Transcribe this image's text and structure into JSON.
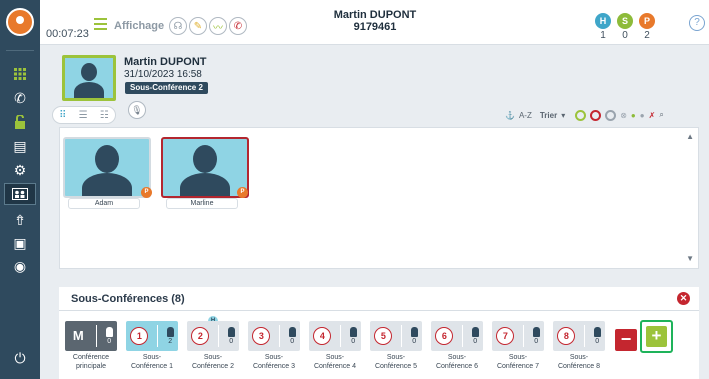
{
  "header": {
    "timer": "00:07:23",
    "display_label": "Affichage",
    "caller_name": "Martin DUPONT",
    "caller_number": "9179461",
    "stats": [
      {
        "letter": "H",
        "count": "1",
        "color": "#3fa6c9"
      },
      {
        "letter": "S",
        "count": "0",
        "color": "#8dbb3a"
      },
      {
        "letter": "P",
        "count": "2",
        "color": "#e8792b"
      }
    ],
    "help": "?"
  },
  "profile": {
    "name": "Martin DUPONT",
    "datetime": "31/10/2023 16:58",
    "conference_badge": "Sous-Conférence 2"
  },
  "toolbar": {
    "sort_az": "A-Z",
    "sort_label": "Trier"
  },
  "participants": [
    {
      "name": "Adam",
      "badge": "P",
      "selected": false
    },
    {
      "name": "Marline",
      "badge": "P",
      "selected": true
    }
  ],
  "subconferences": {
    "title": "Sous-Conférences (8)",
    "main": {
      "letter": "M",
      "count": "0",
      "label_line1": "Conférence",
      "label_line2": "principale"
    },
    "items": [
      {
        "num": "1",
        "count": "2",
        "label_line1": "Sous-",
        "label_line2": "Conférence 1"
      },
      {
        "num": "2",
        "count": "0",
        "label_line1": "Sous-",
        "label_line2": "Conférence 2",
        "badge": "H"
      },
      {
        "num": "3",
        "count": "0",
        "label_line1": "Sous-",
        "label_line2": "Conférence 3"
      },
      {
        "num": "4",
        "count": "0",
        "label_line1": "Sous-",
        "label_line2": "Conférence 4"
      },
      {
        "num": "5",
        "count": "0",
        "label_line1": "Sous-",
        "label_line2": "Conférence 5"
      },
      {
        "num": "6",
        "count": "0",
        "label_line1": "Sous-",
        "label_line2": "Conférence 6"
      },
      {
        "num": "7",
        "count": "0",
        "label_line1": "Sous-",
        "label_line2": "Conférence 7"
      },
      {
        "num": "8",
        "count": "0",
        "label_line1": "Sous-",
        "label_line2": "Conférence 8"
      }
    ],
    "remove_label": "−",
    "add_label": "+"
  },
  "colors": {
    "sidebar": "#2f4a5e",
    "accent_green": "#9cc33b",
    "danger": "#c4262f",
    "avatar_bg": "#8fd4e4"
  },
  "icons": [
    "logo-icon",
    "dialpad-icon",
    "phone-icon",
    "unlock-icon",
    "list-icon",
    "gear-icon",
    "conference-icon",
    "transfer-icon",
    "video-icon",
    "record-icon",
    "power-icon"
  ]
}
